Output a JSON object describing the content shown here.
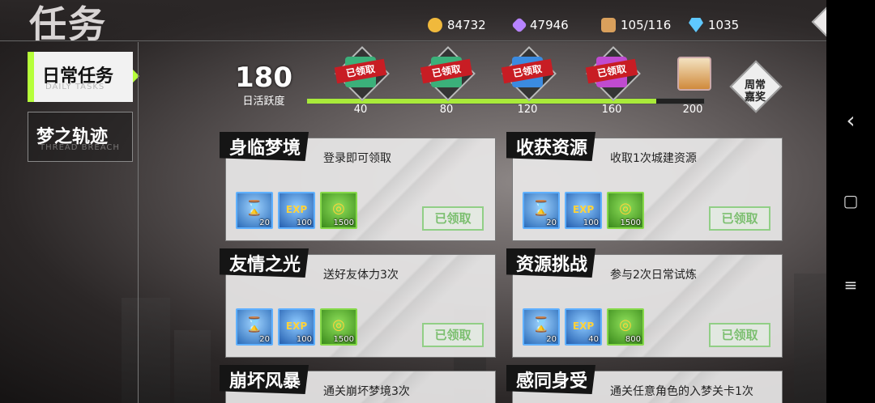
{
  "header": {
    "title": "任务",
    "resources": [
      {
        "icon": "gold-coin-icon",
        "value": "84732",
        "color": "#f0b93c"
      },
      {
        "icon": "crystal-icon",
        "value": "47946",
        "color": "#b783ff"
      },
      {
        "icon": "storage-box-icon",
        "value": "105/116",
        "color": "#d9a05c"
      },
      {
        "icon": "diamond-icon",
        "value": "1035",
        "color": "#5fc8ff"
      }
    ],
    "back_glyph": "↶"
  },
  "sidebar": {
    "tabs": [
      {
        "label": "日常任务",
        "sub": "DAILY TASKS",
        "active": true
      },
      {
        "label": "梦之轨迹",
        "sub": "THREAD BREACH",
        "active": false
      }
    ]
  },
  "activity": {
    "value": "180",
    "label": "日活跃度",
    "progress_percent": 88,
    "milestones": [
      {
        "value": "40",
        "status": "已领取",
        "color": "#3bb07a"
      },
      {
        "value": "80",
        "status": "已领取",
        "color": "#3bb07a"
      },
      {
        "value": "120",
        "status": "已领取",
        "color": "#3b8be0"
      },
      {
        "value": "160",
        "status": "已领取",
        "color": "#c04bd0"
      },
      {
        "value": "200",
        "status": "",
        "color": "#e0a050"
      }
    ],
    "weekly_label_1": "周常",
    "weekly_label_2": "嘉奖"
  },
  "tasks": [
    {
      "name": "身临梦境",
      "desc": "登录即可领取",
      "rewards": [
        "20",
        "100",
        "1500"
      ],
      "status": "已领取"
    },
    {
      "name": "收获资源",
      "desc": "收取1次城建资源",
      "rewards": [
        "20",
        "100",
        "1500"
      ],
      "status": "已领取"
    },
    {
      "name": "友情之光",
      "desc": "送好友体力3次",
      "rewards": [
        "20",
        "100",
        "1500"
      ],
      "status": "已领取"
    },
    {
      "name": "资源挑战",
      "desc": "参与2次日常试炼",
      "rewards": [
        "20",
        "40",
        "800"
      ],
      "status": "已领取"
    },
    {
      "name": "崩坏风暴",
      "desc": "通关崩坏梦境3次",
      "rewards": [],
      "status": ""
    },
    {
      "name": "感同身受",
      "desc": "通关任意角色的入梦关卡1次",
      "rewards": [],
      "status": ""
    }
  ],
  "reward_glyphs": {
    "hourglass": "⌛",
    "exp": "EXP",
    "coins": "◎"
  },
  "navbar": {
    "back": "‹",
    "home": "▢",
    "menu": "≡"
  }
}
